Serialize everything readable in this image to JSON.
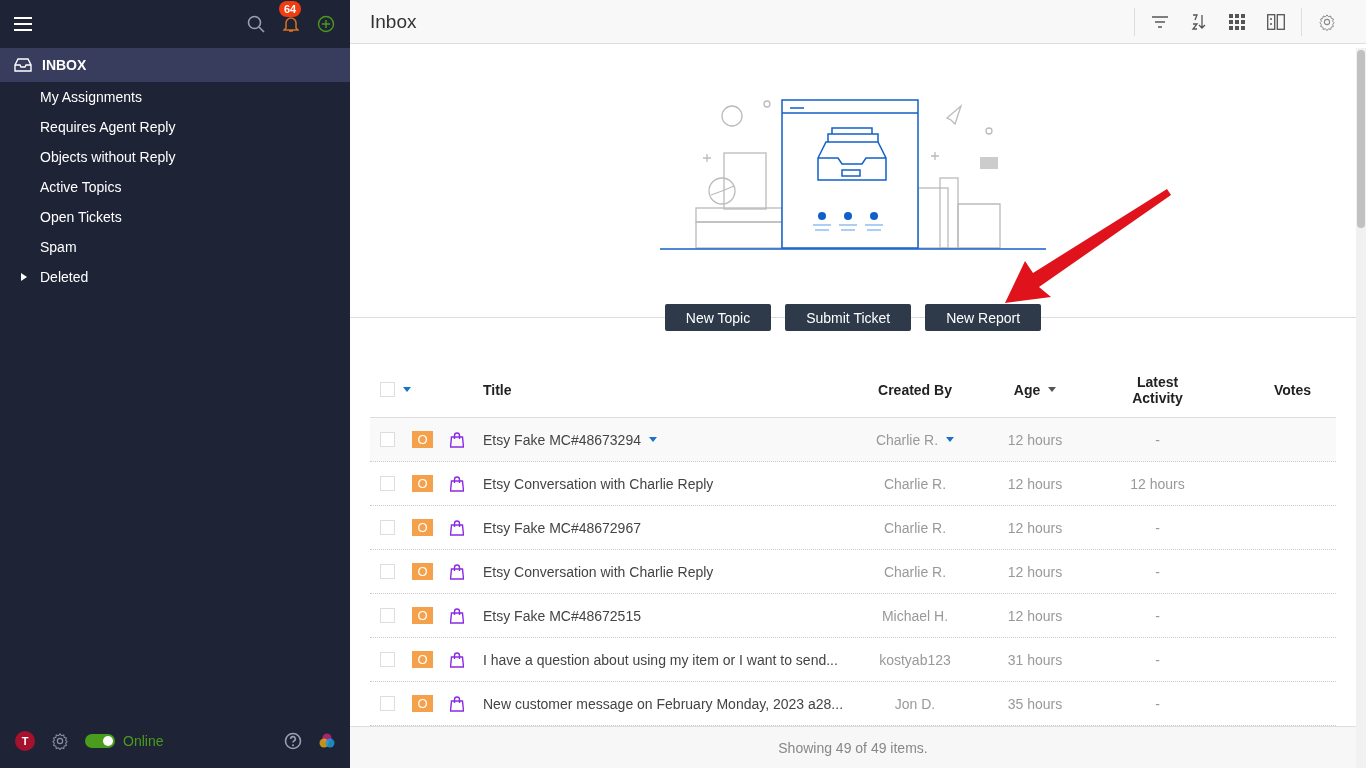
{
  "sidebar": {
    "notification_count": "64",
    "items": [
      {
        "label": "INBOX",
        "selected": true,
        "kind": "heading"
      },
      {
        "label": "My Assignments",
        "selected": false,
        "kind": "item"
      },
      {
        "label": "Requires Agent Reply",
        "selected": false,
        "kind": "item"
      },
      {
        "label": "Objects without Reply",
        "selected": false,
        "kind": "item"
      },
      {
        "label": "Active Topics",
        "selected": false,
        "kind": "item"
      },
      {
        "label": "Open Tickets",
        "selected": false,
        "kind": "item"
      },
      {
        "label": "Spam",
        "selected": false,
        "kind": "item"
      },
      {
        "label": "Deleted",
        "selected": false,
        "kind": "item",
        "expanded": false
      }
    ],
    "footer": {
      "avatar": "T",
      "status": {
        "label": "Online",
        "on": true
      }
    }
  },
  "header": {
    "title": "Inbox"
  },
  "actions": [
    "New Topic",
    "Submit Ticket",
    "New Report"
  ],
  "table": {
    "select_all_checked": false,
    "columns": [
      {
        "label": "Title",
        "sorted": false
      },
      {
        "label": "Created By",
        "sorted": false
      },
      {
        "label": "Age",
        "sorted": true
      },
      {
        "label": "Latest Activity",
        "sorted": false
      },
      {
        "label": "Votes",
        "sorted": false
      }
    ],
    "rows": [
      {
        "badge": "O",
        "title": "Etsy Fake MC#48673294",
        "created_by": "Charlie R.",
        "age": "12 hours",
        "latest_activity": "-",
        "checked": false,
        "hovered": true
      },
      {
        "badge": "O",
        "title": "Etsy Conversation with Charlie Reply",
        "created_by": "Charlie R.",
        "age": "12 hours",
        "latest_activity": "12 hours",
        "checked": false,
        "hovered": false
      },
      {
        "badge": "O",
        "title": "Etsy Fake MC#48672967",
        "created_by": "Charlie R.",
        "age": "12 hours",
        "latest_activity": "-",
        "checked": false,
        "hovered": false
      },
      {
        "badge": "O",
        "title": "Etsy Conversation with Charlie Reply",
        "created_by": "Charlie R.",
        "age": "12 hours",
        "latest_activity": "-",
        "checked": false,
        "hovered": false
      },
      {
        "badge": "O",
        "title": "Etsy Fake MC#48672515",
        "created_by": "Michael H.",
        "age": "12 hours",
        "latest_activity": "-",
        "checked": false,
        "hovered": false
      },
      {
        "badge": "O",
        "title": "I have a question about using my item or I want to send...",
        "created_by": "kostyab123",
        "age": "31 hours",
        "latest_activity": "-",
        "checked": false,
        "hovered": false
      },
      {
        "badge": "O",
        "title": "New customer message on February Monday, 2023 a28...",
        "created_by": "Jon D.",
        "age": "35 hours",
        "latest_activity": "-",
        "checked": false,
        "hovered": false
      }
    ]
  },
  "status_bar": "Showing 49 of 49 items."
}
